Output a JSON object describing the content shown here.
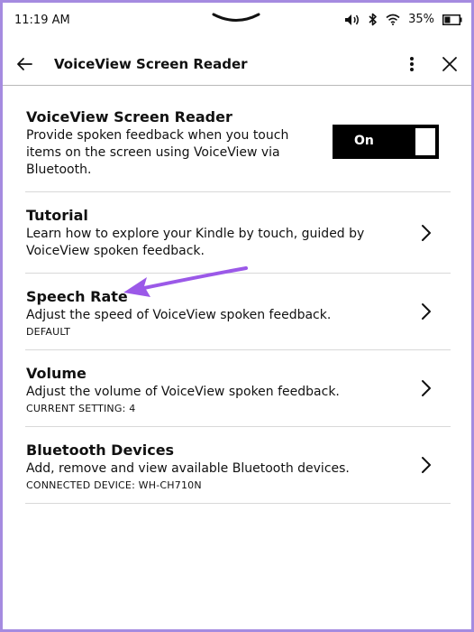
{
  "status_bar": {
    "time": "11:19 AM",
    "battery_percent": "35%"
  },
  "header": {
    "title": "VoiceView Screen Reader"
  },
  "settings": [
    {
      "title": "VoiceView Screen Reader",
      "description": [
        "Provide spoken feedback when you touch",
        "items on the screen using VoiceView via",
        "Bluetooth."
      ],
      "toggle_label": "On"
    },
    {
      "title": "Tutorial",
      "description": [
        "Learn how to explore your Kindle by touch, guided by",
        "VoiceView spoken feedback."
      ]
    },
    {
      "title": "Speech Rate",
      "description": [
        "Adjust the speed of VoiceView spoken feedback."
      ],
      "sub": "DEFAULT"
    },
    {
      "title": "Volume",
      "description": [
        "Adjust the volume of VoiceView spoken feedback."
      ],
      "sub": "CURRENT SETTING: 4"
    },
    {
      "title": "Bluetooth Devices",
      "description": [
        "Add, remove and view available Bluetooth devices."
      ],
      "sub": "CONNECTED DEVICE: WH-CH710N"
    }
  ],
  "colors": {
    "annotation_arrow": "#9b59e8",
    "frame": "#a58be0"
  }
}
